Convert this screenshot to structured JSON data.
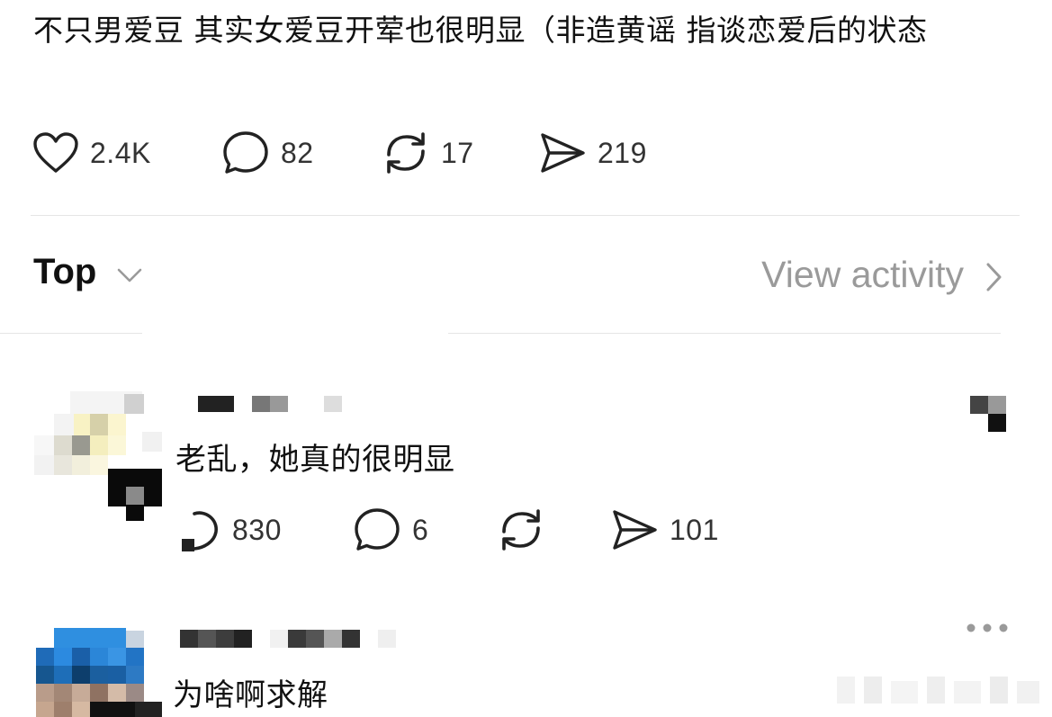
{
  "post": {
    "text": "不只男爱豆 其实女爱豆开荤也很明显（非造黄谣 指谈恋爱后的状态",
    "actions": {
      "like_count": "2.4K",
      "comment_count": "82",
      "repost_count": "17",
      "share_count": "219"
    }
  },
  "sort": {
    "label": "Top",
    "view_activity_label": "View activity"
  },
  "replies": [
    {
      "text": "老乱，她真的很明显",
      "actions": {
        "like_count": "830",
        "comment_count": "6",
        "repost_count": "",
        "share_count": "101"
      }
    },
    {
      "text": "为啥啊求解"
    }
  ],
  "colors": {
    "text": "#111111",
    "muted": "#9a9a9a",
    "divider": "#e6e6e6",
    "icon": "#222222"
  },
  "icons": {
    "like": "heart-icon",
    "comment": "speech-bubble-icon",
    "repost": "repost-arrows-icon",
    "share": "paper-plane-icon",
    "more": "more-dots-icon"
  }
}
